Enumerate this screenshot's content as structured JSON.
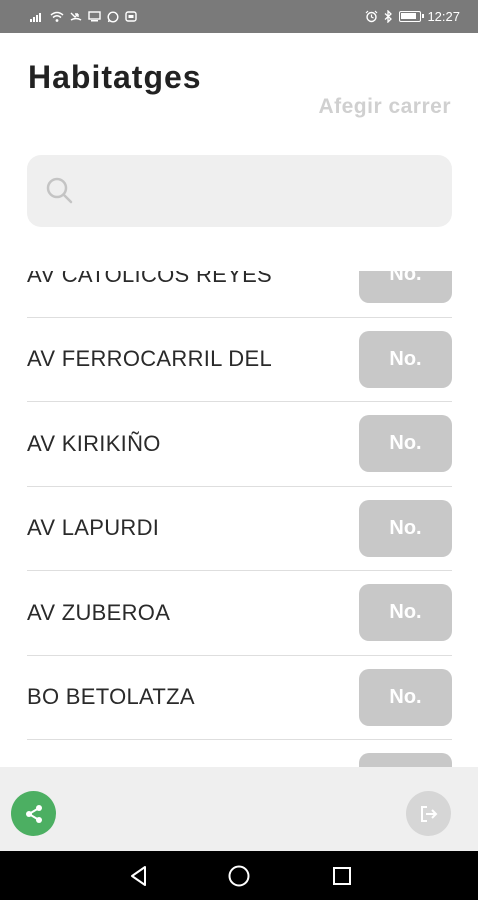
{
  "status_bar": {
    "time": "12:27",
    "left_icons": [
      "signal-icon",
      "wifi-icon",
      "missed-call-icon",
      "screen-icon",
      "whatsapp-icon",
      "notification-icon"
    ],
    "right_icons": [
      "alarm-icon",
      "bluetooth-icon",
      "battery-icon"
    ]
  },
  "header": {
    "title": "Habitatges",
    "add_street_label": "Afegir carrer"
  },
  "search": {
    "value": "",
    "placeholder": ""
  },
  "streets": [
    {
      "name": "AV CATOLICOS REYES",
      "button": "No."
    },
    {
      "name": "AV FERROCARRIL DEL",
      "button": "No."
    },
    {
      "name": "AV KIRIKIÑO",
      "button": "No."
    },
    {
      "name": "AV LAPURDI",
      "button": "No."
    },
    {
      "name": "AV ZUBEROA",
      "button": "No."
    },
    {
      "name": "BO BETOLATZA",
      "button": "No."
    },
    {
      "name": "",
      "button": ""
    }
  ],
  "bottom_bar": {
    "share_icon": "share-icon",
    "logout_icon": "logout-icon"
  },
  "colors": {
    "accent_green": "#4caf62",
    "button_gray": "#c8c8c8",
    "search_bg": "#efefef",
    "status_bar": "#7a7a7a"
  }
}
